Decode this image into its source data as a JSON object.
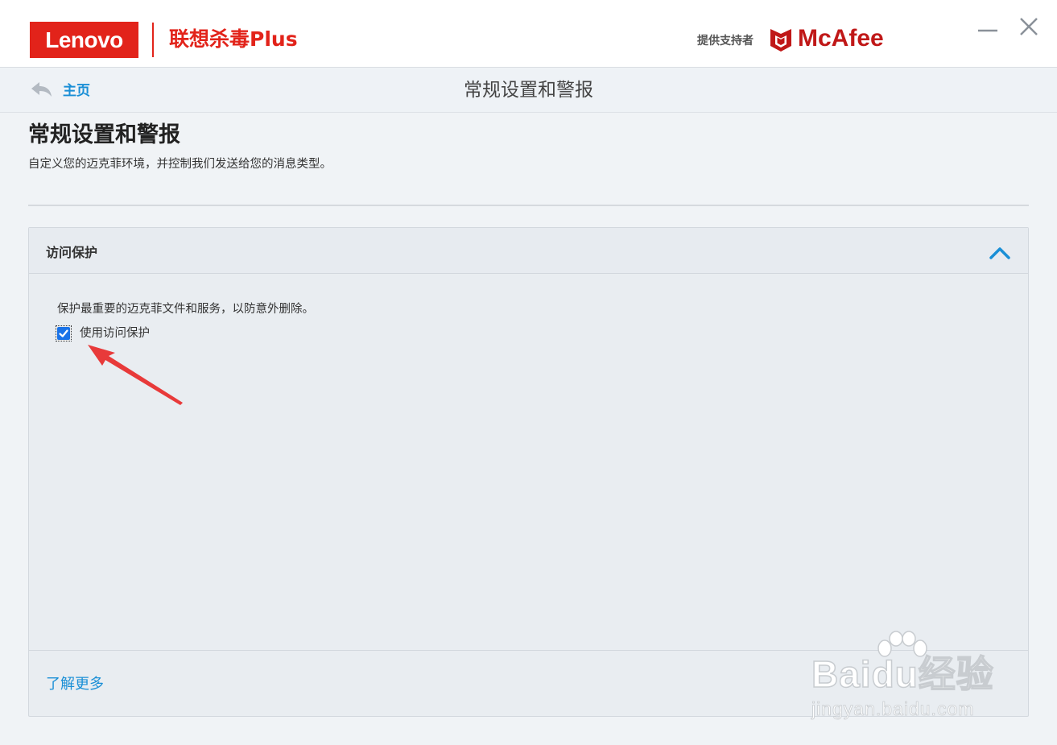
{
  "colors": {
    "brand_red": "#e2231a",
    "mcafee_red": "#c01818",
    "link_blue": "#1a8fd6",
    "checkbox_blue": "#1a73e8",
    "annotation_red": "#e83a3a",
    "panel_bg": "#e9edf1",
    "page_bg": "#f0f3f6"
  },
  "titlebar": {
    "lenovo_logo_text": "Lenovo",
    "product_name": "联想杀毒Plus",
    "powered_by": "提供支持者",
    "mcafee_logo_text": "McAfee",
    "icons": [
      "mcafee-shield-icon",
      "minimize-icon",
      "close-icon"
    ]
  },
  "navbar": {
    "back_icon": "back-arrow-icon",
    "home_label": "主页",
    "title": "常规设置和警报"
  },
  "page": {
    "title": "常规设置和警报",
    "subtitle": "自定义您的迈克菲环境，并控制我们发送给您的消息类型。"
  },
  "panel": {
    "title": "访问保护",
    "collapse_icon": "chevron-up-icon",
    "description": "保护最重要的迈克菲文件和服务，以防意外删除。",
    "checkbox": {
      "label": "使用访问保护",
      "checked": true
    },
    "learn_more": "了解更多"
  },
  "watermark": {
    "main": "Baidu经验",
    "sub": "jingyan.baidu.com"
  }
}
